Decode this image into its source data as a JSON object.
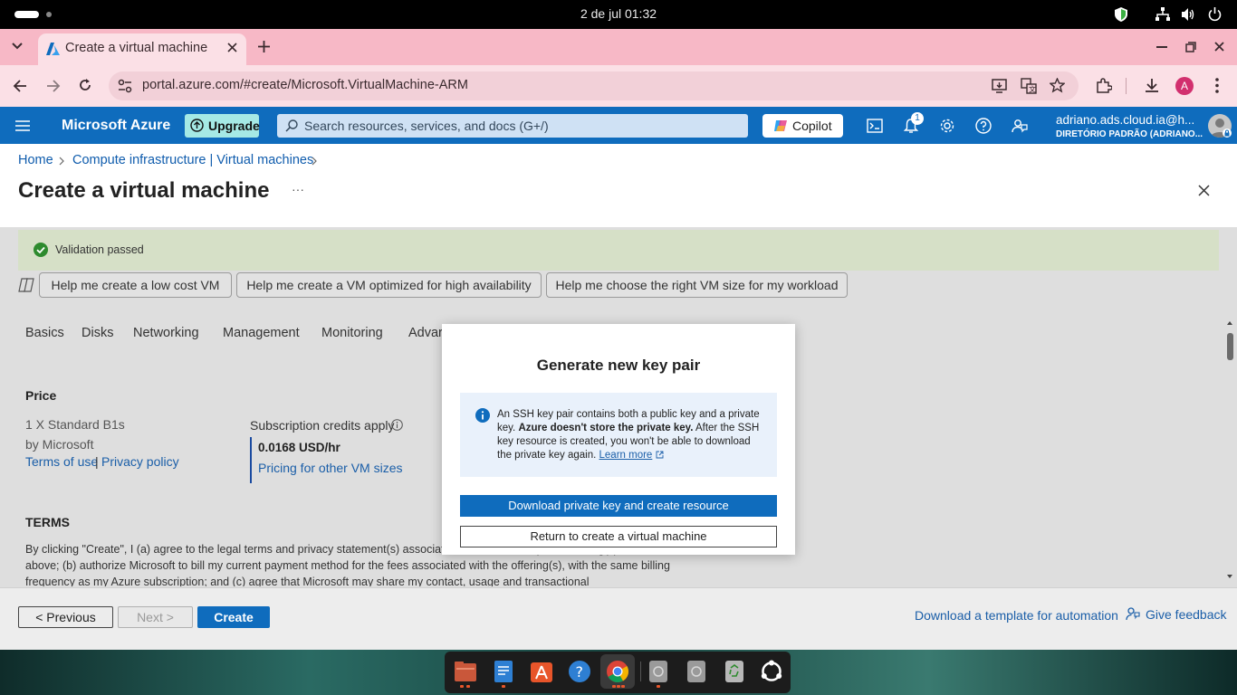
{
  "os": {
    "clock": "2 de jul  01:32"
  },
  "browser": {
    "tab_title": "Create a virtual machine",
    "url": "portal.azure.com/#create/Microsoft.VirtualMachine-ARM",
    "profile_initial": "A"
  },
  "azure": {
    "brand": "Microsoft Azure",
    "upgrade": "Upgrade",
    "search_placeholder": "Search resources, services, and docs (G+/)",
    "copilot": "Copilot",
    "notifications_count": "1",
    "user_email": "adriano.ads.cloud.ia@h...",
    "user_directory": "DIRETÓRIO PADRÃO (ADRIANO..."
  },
  "breadcrumb": {
    "home": "Home",
    "parent": "Compute infrastructure | Virtual machines"
  },
  "page": {
    "title": "Create a virtual machine",
    "more": "···"
  },
  "validation": "Validation passed",
  "help_buttons": [
    "Help me create a low cost VM",
    "Help me create a VM optimized for high availability",
    "Help me choose the right VM size for my workload"
  ],
  "tabs": [
    "Basics",
    "Disks",
    "Networking",
    "Management",
    "Monitoring",
    "Advar"
  ],
  "price": {
    "heading": "Price",
    "sku": "1 X Standard B1s",
    "publisher": "by Microsoft",
    "terms_link": "Terms of use",
    "separator": "|",
    "privacy_link": "Privacy policy",
    "credits": "Subscription credits apply",
    "rate": "0.0168 USD/hr",
    "pricing_link": "Pricing for other VM sizes"
  },
  "terms": {
    "heading": "TERMS",
    "text": "By clicking \"Create\", I (a) agree to the legal terms and privacy statement(s) associated with the Marketplace offering(s) listed above; (b) authorize Microsoft to bill my current payment method for the fees associated with the offering(s), with the same billing frequency as my Azure subscription; and (c) agree that Microsoft may share my contact, usage and transactional"
  },
  "actions": {
    "previous": "< Previous",
    "next": "Next >",
    "create": "Create",
    "download_template": "Download a template for automation",
    "feedback": "Give feedback"
  },
  "modal": {
    "title": "Generate new key pair",
    "info_part1": "An SSH key pair contains both a public key and a private key. ",
    "info_bold": "Azure doesn't store the private key.",
    "info_part2": " After the SSH key resource is created, you won't be able to download the private key again. ",
    "learn_more": "Learn more",
    "primary_button": "Download private key and create resource",
    "secondary_button": "Return to create a virtual machine"
  },
  "colors": {
    "azure_blue": "#0f6cbd",
    "browser_tab": "#f7b8c6",
    "upgrade_badge": "#a5e9e5",
    "validation_green": "#2e8b2e"
  }
}
